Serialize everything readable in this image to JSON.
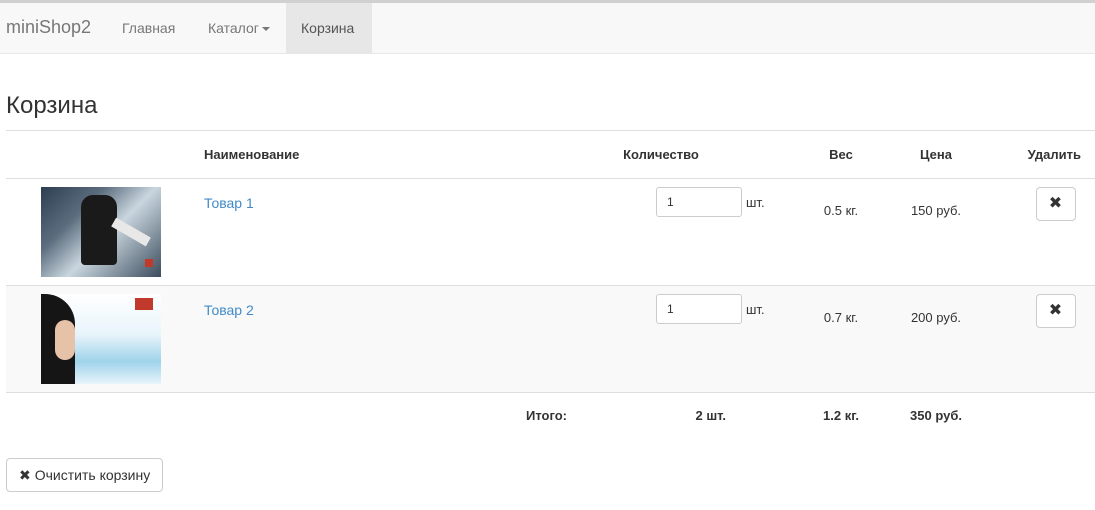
{
  "navbar": {
    "brand": "miniShop2",
    "items": [
      {
        "label": "Главная"
      },
      {
        "label": "Каталог"
      },
      {
        "label": "Корзина"
      }
    ]
  },
  "page": {
    "title": "Корзина"
  },
  "table": {
    "headers": {
      "name": "Наименование",
      "quantity": "Количество",
      "weight": "Вес",
      "price": "Цена",
      "remove": "Удалить"
    },
    "rows": [
      {
        "name": "Товар 1",
        "qty": "1",
        "unit": "шт.",
        "weight": "0.5 кг.",
        "price": "150 руб."
      },
      {
        "name": "Товар 2",
        "qty": "1",
        "unit": "шт.",
        "weight": "0.7 кг.",
        "price": "200 руб."
      }
    ],
    "total": {
      "label": "Итого:",
      "qty": "2 шт.",
      "weight": "1.2 кг.",
      "price": "350 руб."
    }
  },
  "remove_icon": "✖",
  "clear_button": {
    "icon": "✖",
    "label": "Очистить корзину"
  }
}
